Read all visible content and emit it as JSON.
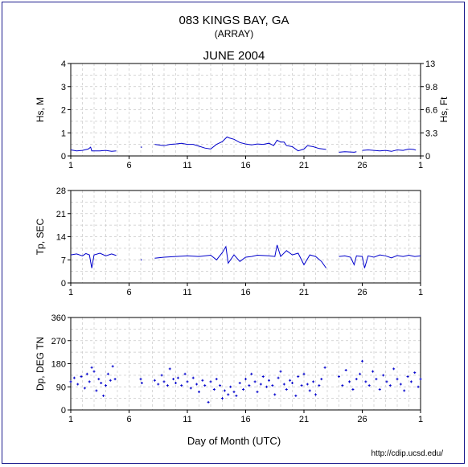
{
  "header": {
    "title": "083 KINGS BAY, GA",
    "subtitle": "(ARRAY)",
    "month": "JUNE 2004"
  },
  "footer": {
    "xlabel": "Day of Month (UTC)",
    "url": "http://cdip.ucsd.edu/"
  },
  "colors": {
    "series": "#0000cc",
    "grid": "#c8c8c8",
    "frame": "#1a1a8c"
  },
  "chart_data": [
    {
      "type": "line",
      "ylabel": "Hs, M",
      "ylabel_right": "Hs, Ft",
      "ylim": [
        0,
        4
      ],
      "yticks": [
        "0",
        "1",
        "2",
        "3",
        "4"
      ],
      "yticks_right": [
        "0",
        "3.3",
        "6.6",
        "9.8",
        "13"
      ],
      "xlim": [
        1,
        31
      ],
      "xticks": [
        "1",
        "6",
        "11",
        "16",
        "21",
        "26",
        "1"
      ],
      "series": [
        {
          "values": [
            [
              1.0,
              0.26
            ],
            [
              1.5,
              0.22
            ],
            [
              2.0,
              0.24
            ],
            [
              2.5,
              0.3
            ],
            [
              2.7,
              0.38
            ],
            [
              2.8,
              0.22
            ],
            [
              3.5,
              0.22
            ],
            [
              4.0,
              0.24
            ],
            [
              4.5,
              0.2
            ],
            [
              4.9,
              0.22
            ]
          ]
        },
        {
          "values": [
            [
              7.0,
              0.38
            ]
          ]
        },
        {
          "values": [
            [
              8.2,
              0.5
            ],
            [
              8.5,
              0.48
            ],
            [
              9.0,
              0.44
            ],
            [
              9.5,
              0.5
            ],
            [
              10.0,
              0.52
            ],
            [
              10.5,
              0.55
            ],
            [
              11.0,
              0.5
            ],
            [
              11.5,
              0.5
            ],
            [
              12.0,
              0.42
            ],
            [
              12.5,
              0.34
            ],
            [
              13.0,
              0.3
            ],
            [
              13.5,
              0.5
            ],
            [
              14.0,
              0.62
            ],
            [
              14.4,
              0.82
            ],
            [
              14.6,
              0.78
            ],
            [
              15.0,
              0.72
            ],
            [
              15.5,
              0.58
            ],
            [
              16.0,
              0.52
            ],
            [
              16.5,
              0.48
            ],
            [
              17.0,
              0.52
            ],
            [
              17.5,
              0.5
            ],
            [
              18.0,
              0.55
            ],
            [
              18.4,
              0.45
            ],
            [
              18.7,
              0.68
            ],
            [
              19.0,
              0.6
            ],
            [
              19.3,
              0.6
            ],
            [
              19.5,
              0.45
            ],
            [
              20.0,
              0.4
            ],
            [
              20.5,
              0.22
            ],
            [
              21.0,
              0.3
            ],
            [
              21.3,
              0.44
            ],
            [
              21.8,
              0.4
            ],
            [
              22.3,
              0.32
            ],
            [
              22.9,
              0.28
            ]
          ]
        },
        {
          "values": [
            [
              24.0,
              0.16
            ],
            [
              24.5,
              0.18
            ],
            [
              25.3,
              0.16
            ],
            [
              25.5,
              0.18
            ]
          ]
        },
        {
          "values": [
            [
              26.0,
              0.24
            ],
            [
              26.5,
              0.26
            ],
            [
              27.0,
              0.24
            ],
            [
              27.5,
              0.22
            ],
            [
              28.0,
              0.24
            ],
            [
              28.5,
              0.2
            ],
            [
              29.0,
              0.26
            ],
            [
              29.5,
              0.24
            ],
            [
              30.0,
              0.3
            ],
            [
              30.4,
              0.28
            ],
            [
              30.6,
              0.25
            ]
          ]
        }
      ]
    },
    {
      "type": "line",
      "ylabel": "Tp, SEC",
      "ylim": [
        0,
        28
      ],
      "yticks": [
        "0",
        "7",
        "14",
        "21",
        "28"
      ],
      "xlim": [
        1,
        31
      ],
      "xticks": [
        "1",
        "6",
        "11",
        "16",
        "21",
        "26",
        "1"
      ],
      "series": [
        {
          "values": [
            [
              1.0,
              8.5
            ],
            [
              1.5,
              8.8
            ],
            [
              2.0,
              8.2
            ],
            [
              2.3,
              8.9
            ],
            [
              2.6,
              8.5
            ],
            [
              2.8,
              4.5
            ],
            [
              3.0,
              8.5
            ],
            [
              3.5,
              9.0
            ],
            [
              4.0,
              8.2
            ],
            [
              4.5,
              8.8
            ],
            [
              4.9,
              8.3
            ]
          ]
        },
        {
          "values": [
            [
              7.0,
              7.0
            ]
          ]
        },
        {
          "values": [
            [
              8.2,
              7.5
            ],
            [
              9.0,
              7.8
            ],
            [
              10.0,
              8.0
            ],
            [
              11.0,
              8.2
            ],
            [
              12.0,
              8.0
            ],
            [
              13.0,
              8.4
            ],
            [
              13.5,
              7.0
            ],
            [
              14.0,
              9.2
            ],
            [
              14.3,
              11.0
            ],
            [
              14.5,
              6.0
            ],
            [
              15.0,
              8.5
            ],
            [
              15.5,
              6.5
            ],
            [
              16.0,
              7.8
            ],
            [
              16.5,
              8.0
            ],
            [
              17.0,
              8.4
            ],
            [
              18.0,
              8.2
            ],
            [
              18.5,
              8.0
            ],
            [
              18.7,
              11.5
            ],
            [
              19.0,
              8.0
            ],
            [
              19.5,
              9.8
            ],
            [
              20.0,
              8.5
            ],
            [
              20.5,
              9.0
            ],
            [
              21.0,
              5.5
            ],
            [
              21.5,
              8.5
            ],
            [
              22.0,
              8.0
            ],
            [
              22.5,
              6.5
            ],
            [
              22.9,
              4.5
            ]
          ]
        },
        {
          "values": [
            [
              24.0,
              8.0
            ],
            [
              24.5,
              8.2
            ],
            [
              25.0,
              7.8
            ],
            [
              25.3,
              5.5
            ],
            [
              25.5,
              8.2
            ],
            [
              26.0,
              8.0
            ],
            [
              26.2,
              4.5
            ],
            [
              26.5,
              8.2
            ],
            [
              27.0,
              7.8
            ],
            [
              27.5,
              8.5
            ],
            [
              28.0,
              8.2
            ],
            [
              28.5,
              7.6
            ],
            [
              29.0,
              8.3
            ],
            [
              29.5,
              8.0
            ],
            [
              30.0,
              8.4
            ],
            [
              30.5,
              8.0
            ],
            [
              31.0,
              8.2
            ]
          ]
        }
      ]
    },
    {
      "type": "scatter",
      "ylabel": "Dp, DEG TN",
      "ylim": [
        0,
        360
      ],
      "yticks": [
        "0",
        "90",
        "180",
        "270",
        "360"
      ],
      "xlim": [
        1,
        31
      ],
      "xticks": [
        "1",
        "6",
        "11",
        "16",
        "21",
        "26",
        "1"
      ],
      "series": [
        {
          "values": [
            [
              1.0,
              110
            ],
            [
              1.3,
              125
            ],
            [
              1.6,
              100
            ],
            [
              1.9,
              130
            ],
            [
              2.2,
              85
            ],
            [
              2.4,
              140
            ],
            [
              2.6,
              110
            ],
            [
              2.8,
              165
            ],
            [
              3.0,
              150
            ],
            [
              3.2,
              75
            ],
            [
              3.4,
              120
            ],
            [
              3.6,
              105
            ],
            [
              3.8,
              55
            ],
            [
              4.0,
              95
            ],
            [
              4.2,
              140
            ],
            [
              4.4,
              115
            ],
            [
              4.6,
              170
            ],
            [
              4.8,
              120
            ],
            [
              7.0,
              120
            ],
            [
              7.1,
              105
            ],
            [
              8.2,
              115
            ],
            [
              8.5,
              100
            ],
            [
              8.8,
              135
            ],
            [
              9.0,
              110
            ],
            [
              9.3,
              95
            ],
            [
              9.5,
              160
            ],
            [
              9.8,
              120
            ],
            [
              10.0,
              105
            ],
            [
              10.2,
              125
            ],
            [
              10.5,
              95
            ],
            [
              10.8,
              140
            ],
            [
              11.0,
              110
            ],
            [
              11.3,
              85
            ],
            [
              11.5,
              125
            ],
            [
              11.8,
              100
            ],
            [
              12.0,
              70
            ],
            [
              12.3,
              115
            ],
            [
              12.5,
              95
            ],
            [
              12.8,
              30
            ],
            [
              13.0,
              110
            ],
            [
              13.3,
              80
            ],
            [
              13.5,
              120
            ],
            [
              13.8,
              95
            ],
            [
              14.0,
              45
            ],
            [
              14.2,
              75
            ],
            [
              14.5,
              60
            ],
            [
              14.7,
              90
            ],
            [
              15.0,
              70
            ],
            [
              15.2,
              55
            ],
            [
              15.5,
              105
            ],
            [
              15.8,
              80
            ],
            [
              16.0,
              120
            ],
            [
              16.3,
              95
            ],
            [
              16.5,
              140
            ],
            [
              16.8,
              110
            ],
            [
              17.0,
              70
            ],
            [
              17.3,
              100
            ],
            [
              17.5,
              130
            ],
            [
              17.8,
              90
            ],
            [
              18.0,
              115
            ],
            [
              18.3,
              95
            ],
            [
              18.5,
              60
            ],
            [
              18.8,
              125
            ],
            [
              19.0,
              150
            ],
            [
              19.3,
              100
            ],
            [
              19.5,
              80
            ],
            [
              19.8,
              115
            ],
            [
              20.0,
              105
            ],
            [
              20.3,
              55
            ],
            [
              20.5,
              130
            ],
            [
              20.8,
              95
            ],
            [
              21.0,
              140
            ],
            [
              21.3,
              100
            ],
            [
              21.5,
              75
            ],
            [
              21.8,
              110
            ],
            [
              22.0,
              60
            ],
            [
              22.3,
              95
            ],
            [
              22.5,
              120
            ],
            [
              22.8,
              165
            ],
            [
              24.0,
              130
            ],
            [
              24.3,
              95
            ],
            [
              24.6,
              155
            ],
            [
              24.9,
              110
            ],
            [
              25.2,
              80
            ],
            [
              25.5,
              120
            ],
            [
              25.8,
              140
            ],
            [
              26.0,
              190
            ],
            [
              26.3,
              110
            ],
            [
              26.6,
              95
            ],
            [
              26.9,
              150
            ],
            [
              27.2,
              120
            ],
            [
              27.5,
              80
            ],
            [
              27.8,
              135
            ],
            [
              28.1,
              110
            ],
            [
              28.4,
              95
            ],
            [
              28.7,
              160
            ],
            [
              29.0,
              120
            ],
            [
              29.3,
              100
            ],
            [
              29.6,
              75
            ],
            [
              29.9,
              130
            ],
            [
              30.2,
              110
            ],
            [
              30.5,
              145
            ],
            [
              30.8,
              90
            ],
            [
              31.0,
              120
            ]
          ]
        }
      ]
    }
  ]
}
